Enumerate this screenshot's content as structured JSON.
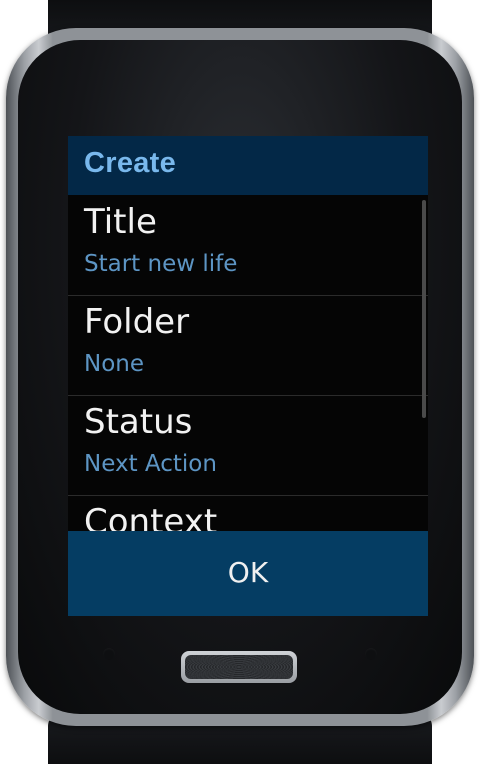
{
  "screen": {
    "header": {
      "title": "Create"
    },
    "fields": [
      {
        "label": "Title",
        "value": "Start new life"
      },
      {
        "label": "Folder",
        "value": "None"
      },
      {
        "label": "Status",
        "value": "Next Action"
      },
      {
        "label": "Context",
        "value": ""
      }
    ],
    "ok_label": "OK"
  },
  "colors": {
    "header_bg": "#032847",
    "header_text": "#79b8ec",
    "item_value_text": "#5d95c4",
    "ok_bg": "#053d63",
    "screen_bg": "#050505"
  },
  "icons": {
    "home_button": "home-button-icon"
  }
}
